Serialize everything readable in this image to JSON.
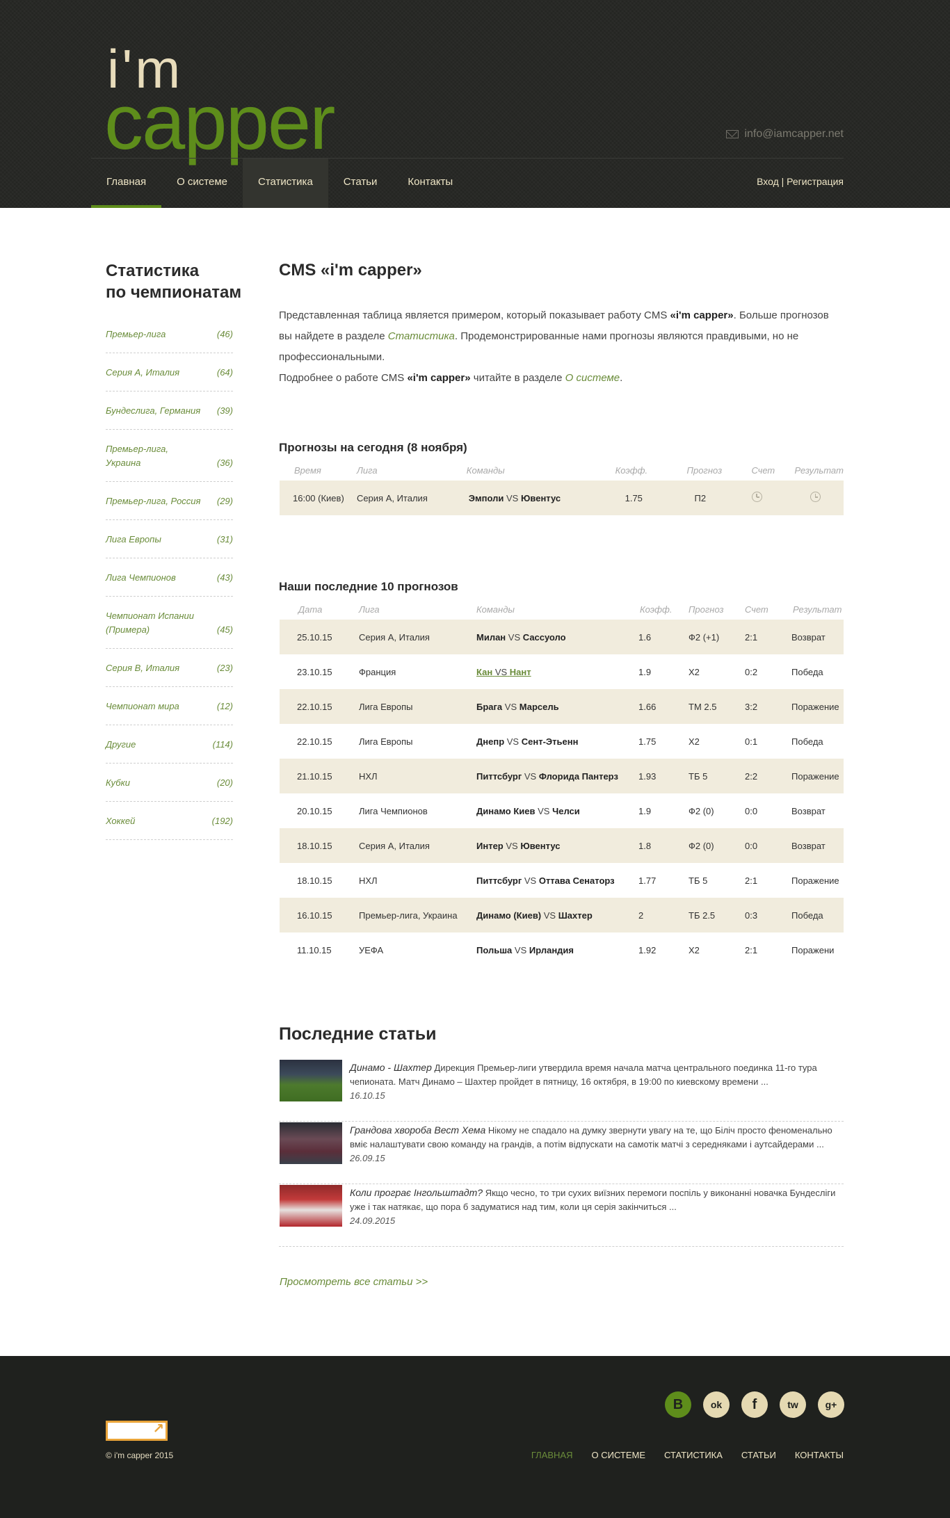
{
  "header": {
    "logo_top": "i'm",
    "logo_bottom": "capper",
    "email": "info@iamcapper.net",
    "nav": [
      "Главная",
      "О системе",
      "Статистика",
      "Статьи",
      "Контакты"
    ],
    "auth": "Вход | Регистрация"
  },
  "sidebar": {
    "title_line1": "Статистика",
    "title_line2": "по чемпионатам",
    "items": [
      {
        "name": "Премьер-лига",
        "count": "(46)"
      },
      {
        "name": "Серия А, Италия",
        "count": "(64)"
      },
      {
        "name": "Бундеслига, Германия",
        "count": "(39)"
      },
      {
        "name": "Премьер-лига, Украина",
        "count": "(36)"
      },
      {
        "name": "Премьер-лига, Россия",
        "count": "(29)"
      },
      {
        "name": "Лига Европы",
        "count": "(31)"
      },
      {
        "name": "Лига Чемпионов",
        "count": "(43)"
      },
      {
        "name": "Чемпионат Испании (Примера)",
        "count": "(45)"
      },
      {
        "name": "Серия В, Италия",
        "count": "(23)"
      },
      {
        "name": "Чемпионат мира",
        "count": "(12)"
      },
      {
        "name": "Другие",
        "count": "(114)"
      },
      {
        "name": "Кубки",
        "count": "(20)"
      },
      {
        "name": "Хоккей",
        "count": "(192)"
      }
    ]
  },
  "main": {
    "title": "CMS «i'm capper»",
    "intro": {
      "p1_a": "Представленная таблица является примером, который показывает работу CMS ",
      "p1_b": "«i'm capper»",
      "p1_c": ".  Больше прогнозов вы найдете в разделе ",
      "p1_link": "Статистика",
      "p1_d": ". Продемонстрированные нами прогнозы являются правдивыми, но не профессиональными.",
      "p2_a": "Подробнее о работе CMS ",
      "p2_b": "«i'm capper»",
      "p2_c": " читайте в разделе ",
      "p2_link": "О системе",
      "p2_d": "."
    },
    "today": {
      "title": "Прогнозы на сегодня (8 ноября)",
      "headers": [
        "Время",
        "Лига",
        "Команды",
        "Коэфф.",
        "Прогноз",
        "Счет",
        "Результат"
      ],
      "rows": [
        {
          "time": "16:00 (Киев)",
          "league": "Серия А, Италия",
          "home": "Эмполи",
          "vs": "VS",
          "away": "Ювентус",
          "coef": "1.75",
          "forecast": "П2",
          "score_icon": "clock-icon",
          "result_icon": "clock-icon"
        }
      ]
    },
    "last10": {
      "title": "Наши последние 10 прогнозов",
      "headers": [
        "Дата",
        "Лига",
        "Команды",
        "Коэфф.",
        "Прогноз",
        "Счет",
        "Результат"
      ],
      "rows": [
        {
          "date": "25.10.15",
          "league": "Серия А, Италия",
          "home": "Милан",
          "vs": "VS",
          "away": "Сассуоло",
          "coef": "1.6",
          "forecast": "Ф2 (+1)",
          "score": "2:1",
          "result": "Возврат"
        },
        {
          "date": "23.10.15",
          "league": "Франция",
          "home": "Кан",
          "vs": "VS",
          "away": "Нант",
          "coef": "1.9",
          "forecast": "Х2",
          "score": "0:2",
          "result": "Победа"
        },
        {
          "date": "22.10.15",
          "league": "Лига Европы",
          "home": "Брага",
          "vs": "VS",
          "away": "Марсель",
          "coef": "1.66",
          "forecast": "ТМ 2.5",
          "score": "3:2",
          "result": "Поражение"
        },
        {
          "date": "22.10.15",
          "league": "Лига Европы",
          "home": "Днепр",
          "vs": "VS",
          "away": "Сент-Этьенн",
          "coef": "1.75",
          "forecast": "Х2",
          "score": "0:1",
          "result": "Победа"
        },
        {
          "date": "21.10.15",
          "league": "НХЛ",
          "home": "Питтсбург",
          "vs": "VS",
          "away": "Флорида Пантерз",
          "coef": "1.93",
          "forecast": "ТБ 5",
          "score": "2:2",
          "result": "Поражение"
        },
        {
          "date": "20.10.15",
          "league": "Лига Чемпионов",
          "home": "Динамо Киев",
          "vs": "VS",
          "away": "Челси",
          "coef": "1.9",
          "forecast": "Ф2 (0)",
          "score": "0:0",
          "result": "Возврат"
        },
        {
          "date": "18.10.15",
          "league": "Серия А, Италия",
          "home": "Интер",
          "vs": "VS",
          "away": "Ювентус",
          "coef": "1.8",
          "forecast": "Ф2 (0)",
          "score": "0:0",
          "result": "Возврат"
        },
        {
          "date": "18.10.15",
          "league": "НХЛ",
          "home": "Питтсбург",
          "vs": "VS",
          "away": "Оттава Сенаторз",
          "coef": "1.77",
          "forecast": "ТБ 5",
          "score": "2:1",
          "result": "Поражение"
        },
        {
          "date": "16.10.15",
          "league": "Премьер-лига, Украина",
          "home": "Динамо (Киев)",
          "vs": "VS",
          "away": "Шахтер",
          "coef": "2",
          "forecast": "ТБ 2.5",
          "score": "0:3",
          "result": "Победа"
        },
        {
          "date": "11.10.15",
          "league": "УЕФА",
          "home": "Польша",
          "vs": "VS",
          "away": "Ирландия",
          "coef": "1.92",
          "forecast": "Х2",
          "score": "2:1",
          "result": "Поражени"
        }
      ]
    },
    "articles": {
      "title": "Последние статьи",
      "items": [
        {
          "title": "Динамо - Шахтер",
          "text": "Дирекция Премьер-лиги утвердила время начала матча центрального поединка 11-го тура чепионата. Матч Динамо – Шахтер пройдет в пятницу, 16 октября, в 19:00 по киевскому времени ...",
          "date": "16.10.15"
        },
        {
          "title": "Грандова хвороба Вест Хема",
          "text": "Нікому не спадало на думку звернути увагу на те, що Біліч просто феноменально вміє налаштувати свою команду на грандів, а потім відпускати на самотік матчі з середняками і аутсайдерами ...",
          "date": "26.09.15"
        },
        {
          "title": "Коли програє Інгольштадт?",
          "text": "Якщо чесно, то три сухих виїзних перемоги поспіль у виконанні новачка Бундесліги уже і так натякає, що пора б задуматися над тим, коли ця серія закінчиться ...",
          "date": "24.09.2015"
        }
      ],
      "all_link": "Просмотреть все статьи >>"
    }
  },
  "footer": {
    "social": [
      "В",
      "ok",
      "f",
      "tw",
      "g+"
    ],
    "copyright": "© i'm capper 2015",
    "nav": [
      "ГЛАВНАЯ",
      "О СИСТЕМЕ",
      "СТАТИСТИКА",
      "СТАТЬИ",
      "КОНТАКТЫ"
    ]
  },
  "colors": {
    "accent_green": "#5e8d1b",
    "link_green": "#6a8c3a",
    "beige_row": "#f1ecdd",
    "header_bg": "#262724",
    "footer_bg": "#1f211e",
    "logo_cream": "#e8dcbb"
  }
}
